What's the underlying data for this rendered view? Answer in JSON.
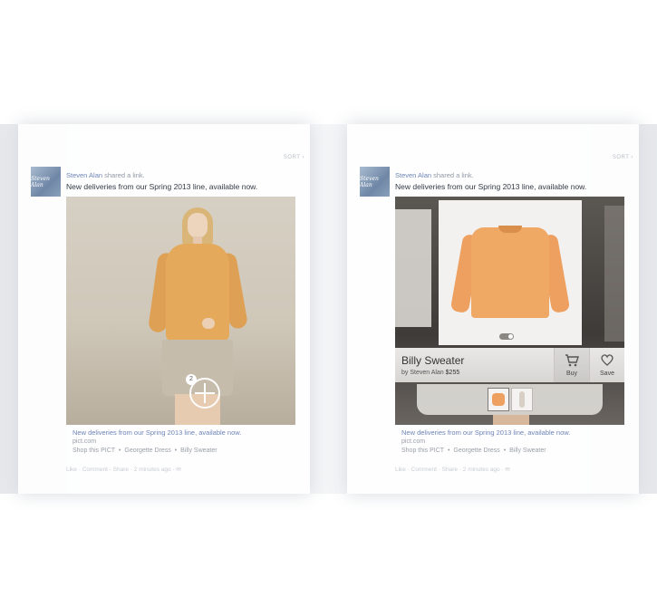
{
  "panels": [
    {
      "sort_label": "SORT ›",
      "avatar_text": "Steven Alan",
      "poster_name": "Steven Alan",
      "poster_action": "shared a link.",
      "message": "New deliveries from our Spring 2013 line, available now.",
      "hotspot_count": "2",
      "caption_title": "New deliveries from our Spring 2013 line, available now.",
      "caption_domain": "pict.com",
      "shop_prefix": "Shop this PICT",
      "shop_items": [
        "Georgette Dress",
        "Billy Sweater"
      ],
      "actions": "Like · Comment · Share · 2 minutes ago · ✉"
    },
    {
      "sort_label": "SORT ›",
      "avatar_text": "Steven Alan",
      "poster_name": "Steven Alan",
      "poster_action": "shared a link.",
      "message": "New deliveries from our Spring 2013 line, available now.",
      "product": {
        "name": "Billy Sweater",
        "brand": "by Steven Alan",
        "price": "$255",
        "buy_label": "Buy",
        "save_label": "Save"
      },
      "caption_title": "New deliveries from our Spring 2013 line, available now.",
      "caption_domain": "pict.com",
      "shop_prefix": "Shop this PICT",
      "shop_items": [
        "Georgette Dress",
        "Billy Sweater"
      ],
      "actions": "Like · Comment · Share · 2 minutes ago · ✉"
    }
  ],
  "colors": {
    "link_blue": "#6e85b7",
    "sweater_orange": "#f0a865",
    "band_gray": "#eceef1"
  },
  "icons": [
    "cart-icon",
    "heart-icon",
    "plus-circle-icon",
    "toggle-icon"
  ]
}
